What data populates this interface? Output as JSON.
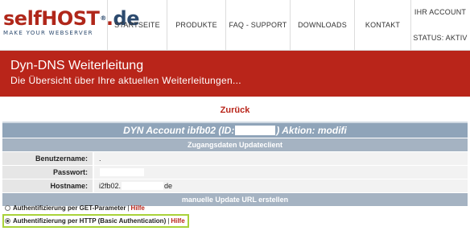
{
  "logo": {
    "self": "self",
    "host": "HOST",
    "dot": ".",
    "tld": "de",
    "reg": "®",
    "tagline": "MAKE YOUR WEBSERVER"
  },
  "nav": {
    "startseite": "STARTSEITE",
    "produkte": "PRODUKTE",
    "faq": "FAQ - SUPPORT",
    "downloads": "DOWNLOADS",
    "kontakt": "KONTAKT",
    "account": "IHR ACCOUNT",
    "status": "STATUS: AKTIV"
  },
  "banner": {
    "title": "Dyn-DNS Weiterleitung",
    "subtitle": "Die Übersicht über Ihre aktuellen Weiterleitungen..."
  },
  "back_link": "Zurück",
  "account_table": {
    "title_prefix": "DYN Account ibfb02 (ID:",
    "title_suffix": ") Aktion: modifi",
    "section_credentials": "Zugangsdaten Updateclient",
    "fields": [
      {
        "label": "Benutzername:",
        "value": "."
      },
      {
        "label": "Passwort:",
        "value": ""
      },
      {
        "label": "Hostname:",
        "value_prefix": "i2fb02.",
        "value_suffix": "de"
      }
    ],
    "section_manual": "manuelle Update URL erstellen"
  },
  "auth_options": [
    {
      "label": "Authentifizierung per GET-Parameter",
      "help": "Hilfe",
      "checked": false
    },
    {
      "label": "Authentifizierung per HTTP (Basic Authentication)",
      "help": "Hilfe",
      "checked": true
    }
  ],
  "colors": {
    "brand_red": "#b9251a",
    "table_header": "#8fa4b9",
    "table_subheader": "#a5b3c2",
    "highlight": "#a9d23a"
  }
}
